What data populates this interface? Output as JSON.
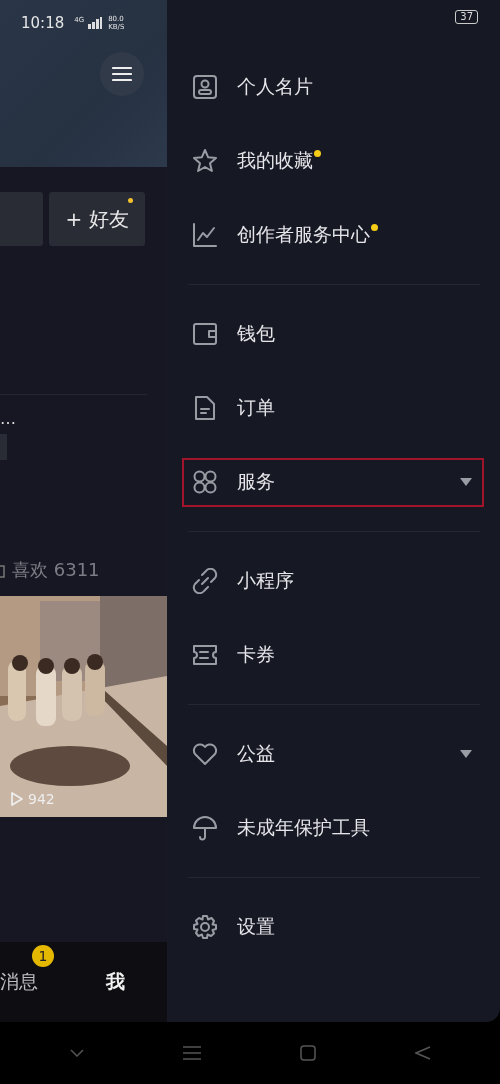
{
  "status_bar": {
    "time": "10:18",
    "network": "4G",
    "speed": "80.0",
    "speed_unit": "KB/S",
    "battery": "37"
  },
  "left_pane": {
    "add_friend_button": {
      "label": "+ 好友",
      "dot": true
    },
    "truncated_text": "…",
    "likes": "喜欢 6311",
    "video": {
      "views": "942"
    },
    "tabs": [
      {
        "label": "消息",
        "badge": "1",
        "selected": false
      },
      {
        "label": "我",
        "selected": true
      }
    ]
  },
  "drawer": {
    "groups": [
      {
        "items": [
          {
            "label": "个人名片",
            "dot": false,
            "expandable": false,
            "highlighted": false
          },
          {
            "label": "我的收藏",
            "dot": true,
            "expandable": false,
            "highlighted": false
          },
          {
            "label": "创作者服务中心",
            "dot": true,
            "expandable": false,
            "highlighted": false
          }
        ]
      },
      {
        "items": [
          {
            "label": "钱包",
            "dot": false,
            "expandable": false,
            "highlighted": false
          },
          {
            "label": "订单",
            "dot": false,
            "expandable": false,
            "highlighted": false
          },
          {
            "label": "服务",
            "dot": false,
            "expandable": true,
            "highlighted": true
          }
        ]
      },
      {
        "items": [
          {
            "label": "小程序",
            "dot": false,
            "expandable": false,
            "highlighted": false
          },
          {
            "label": "卡券",
            "dot": false,
            "expandable": false,
            "highlighted": false
          }
        ]
      },
      {
        "items": [
          {
            "label": "公益",
            "dot": false,
            "expandable": true,
            "highlighted": false
          },
          {
            "label": "未成年保护工具",
            "dot": false,
            "expandable": false,
            "highlighted": false
          }
        ]
      },
      {
        "items": [
          {
            "label": "设置",
            "dot": false,
            "expandable": false,
            "highlighted": false
          }
        ]
      }
    ]
  }
}
